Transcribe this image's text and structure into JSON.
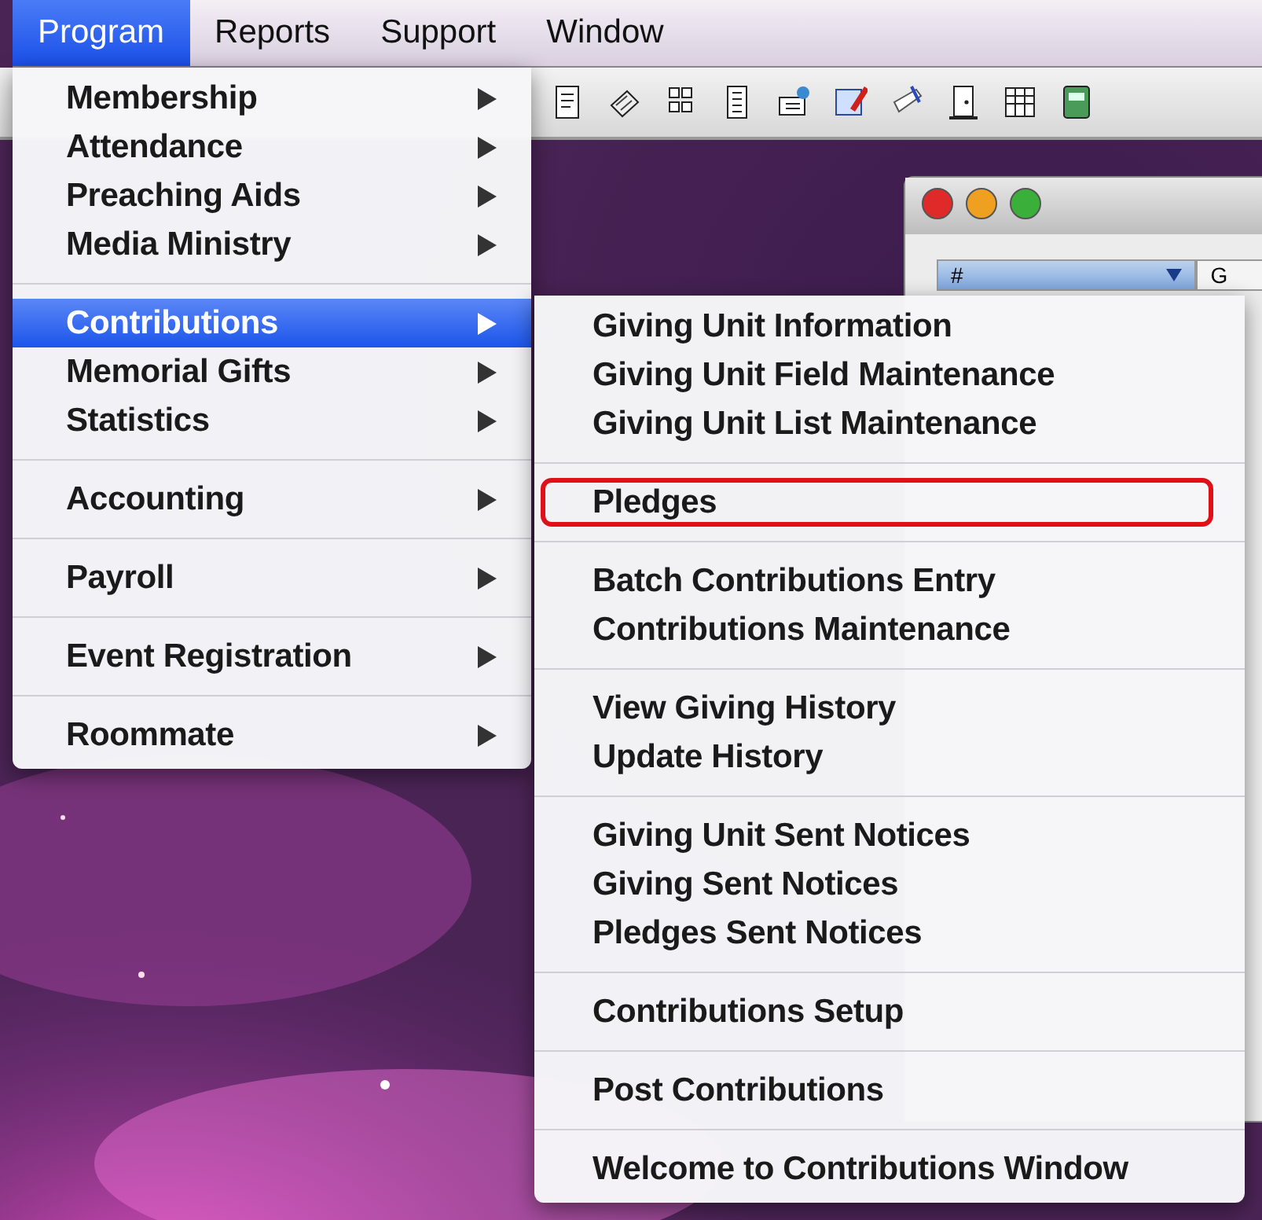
{
  "menu_bar": [
    {
      "label": "Program",
      "selected": true
    },
    {
      "label": "Reports",
      "selected": false
    },
    {
      "label": "Support",
      "selected": false
    },
    {
      "label": "Window",
      "selected": false
    }
  ],
  "background_window": {
    "columns": [
      {
        "label": "#",
        "selected": true
      },
      {
        "label": "G",
        "selected": false
      }
    ]
  },
  "program_menu": [
    [
      {
        "label": "Membership",
        "selected": false,
        "has_submenu": true
      },
      {
        "label": "Attendance",
        "selected": false,
        "has_submenu": true
      },
      {
        "label": "Preaching Aids",
        "selected": false,
        "has_submenu": true
      },
      {
        "label": "Media Ministry",
        "selected": false,
        "has_submenu": true
      }
    ],
    [
      {
        "label": "Contributions",
        "selected": true,
        "has_submenu": true
      },
      {
        "label": "Memorial Gifts",
        "selected": false,
        "has_submenu": true
      },
      {
        "label": "Statistics",
        "selected": false,
        "has_submenu": true
      }
    ],
    [
      {
        "label": "Accounting",
        "selected": false,
        "has_submenu": true
      }
    ],
    [
      {
        "label": "Payroll",
        "selected": false,
        "has_submenu": true
      }
    ],
    [
      {
        "label": "Event Registration",
        "selected": false,
        "has_submenu": true
      }
    ],
    [
      {
        "label": "Roommate",
        "selected": false,
        "has_submenu": true
      }
    ]
  ],
  "contributions_submenu": [
    [
      {
        "label": "Giving Unit Information",
        "circled": false
      },
      {
        "label": "Giving Unit Field Maintenance",
        "circled": false
      },
      {
        "label": "Giving Unit List Maintenance",
        "circled": false
      }
    ],
    [
      {
        "label": "Pledges",
        "circled": true
      }
    ],
    [
      {
        "label": "Batch Contributions Entry",
        "circled": false
      },
      {
        "label": "Contributions Maintenance",
        "circled": false
      }
    ],
    [
      {
        "label": "View Giving History",
        "circled": false
      },
      {
        "label": "Update History",
        "circled": false
      }
    ],
    [
      {
        "label": "Giving Unit Sent Notices",
        "circled": false
      },
      {
        "label": "Giving Sent Notices",
        "circled": false
      },
      {
        "label": "Pledges Sent Notices",
        "circled": false
      }
    ],
    [
      {
        "label": "Contributions Setup",
        "circled": false
      }
    ],
    [
      {
        "label": "Post Contributions",
        "circled": false
      }
    ],
    [
      {
        "label": "Welcome to Contributions Window",
        "circled": false
      }
    ]
  ]
}
